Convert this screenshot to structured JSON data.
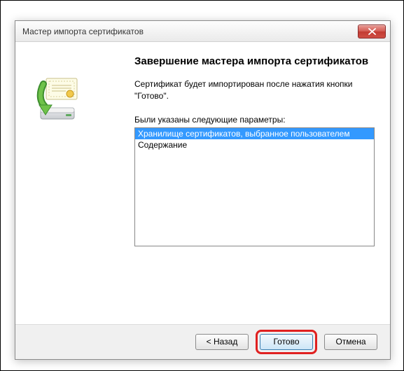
{
  "window": {
    "title": "Мастер импорта сертификатов"
  },
  "content": {
    "heading": "Завершение мастера импорта сертификатов",
    "description": "Сертификат будет импортирован после нажатия кнопки \"Готово\".",
    "params_label": "Были указаны следующие параметры:",
    "rows": [
      "Хранилище сертификатов, выбранное пользователем",
      "Содержание"
    ]
  },
  "buttons": {
    "back": "< Назад",
    "finish": "Готово",
    "cancel": "Отмена"
  },
  "icons": {
    "close": "close-icon",
    "wizard": "certificate-import-icon"
  }
}
